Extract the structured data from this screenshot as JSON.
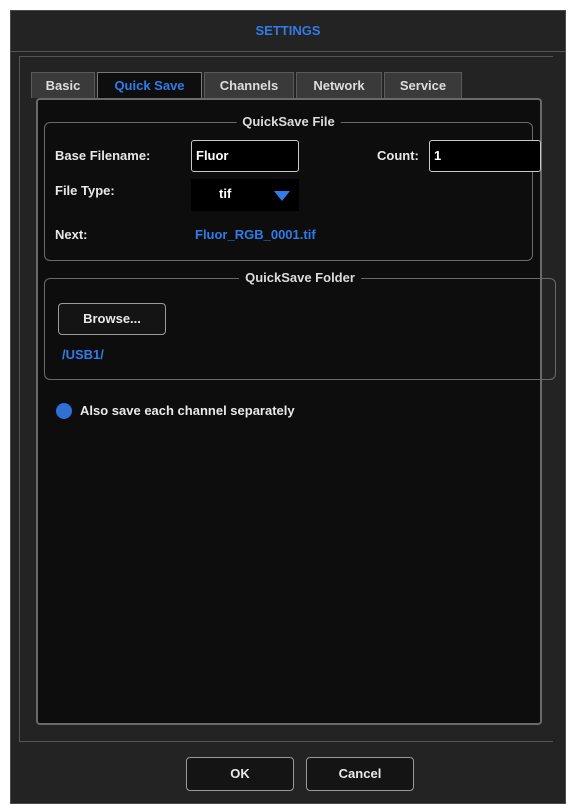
{
  "dialog": {
    "title": "SETTINGS"
  },
  "tabs": [
    {
      "label": "Basic"
    },
    {
      "label": "Quick Save",
      "active": true
    },
    {
      "label": "Channels"
    },
    {
      "label": "Network"
    },
    {
      "label": "Service"
    }
  ],
  "quicksave_file": {
    "legend": "QuickSave File",
    "base_filename_label": "Base Filename:",
    "base_filename_value": "Fluor",
    "count_label": "Count:",
    "count_value": "1",
    "file_type_label": "File Type:",
    "file_type_value": "tif",
    "next_label": "Next:",
    "next_value": "Fluor_RGB_0001.tif"
  },
  "quicksave_folder": {
    "legend": "QuickSave Folder",
    "browse_label": "Browse...",
    "path": "/USB1/"
  },
  "options": {
    "save_channels_label": "Also save each channel separately",
    "save_channels_checked": true
  },
  "footer": {
    "ok_label": "OK",
    "cancel_label": "Cancel"
  },
  "colors": {
    "accent": "#2f7ce8",
    "background": "#232323",
    "panel": "#0d0d0d"
  }
}
